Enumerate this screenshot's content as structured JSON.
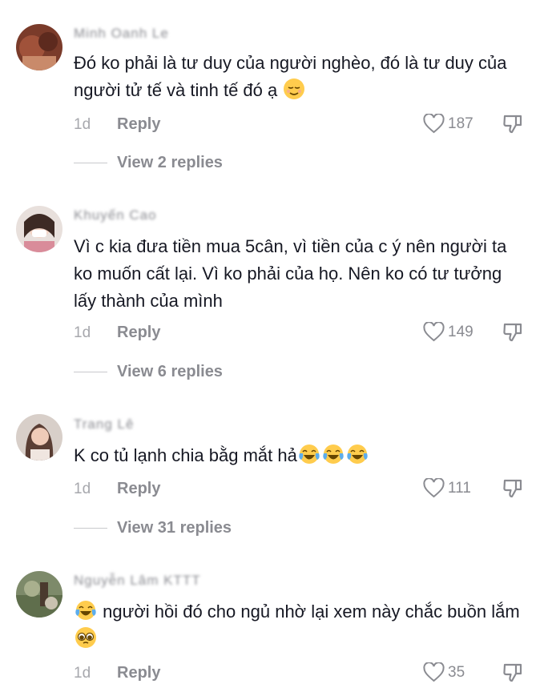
{
  "comments": [
    {
      "username": "Minh Oanh Le",
      "text": "Đó ko phải là tư duy của người nghèo, đó là tư duy của người tử tế và tinh tế đó ạ",
      "emoji_after": "relieved-face-emoji",
      "time": "1d",
      "reply_label": "Reply",
      "likes": "187",
      "view_replies": "View 2 replies"
    },
    {
      "username": "Khuyến Cao",
      "text": "Vì c kia đưa tiền mua 5cân, vì tiền của c ý nên người ta ko muốn cất lại. Vì ko phải của họ. Nên ko có tư tưởng lấy thành của mình",
      "time": "1d",
      "reply_label": "Reply",
      "likes": "149",
      "view_replies": "View 6 replies"
    },
    {
      "username": "Trang Lê",
      "text": "K co tủ lạnh chia bằg mắt hả",
      "emoji_after": "tears-of-joy-emoji",
      "time": "1d",
      "reply_label": "Reply",
      "likes": "111",
      "view_replies": "View 31 replies"
    },
    {
      "username": "Nguyễn Lâm KTTT",
      "text_before_emoji": "người hồi đó cho ngủ nhờ lại xem này chắc buồn lắm",
      "emoji_before": "tears-of-joy-emoji",
      "emoji_after": "pleading-face-emoji",
      "time": "1d",
      "reply_label": "Reply",
      "likes": "35"
    }
  ],
  "colors": {
    "text": "#161823",
    "secondary": "#8a8b91",
    "muted": "#a7a8ad"
  }
}
